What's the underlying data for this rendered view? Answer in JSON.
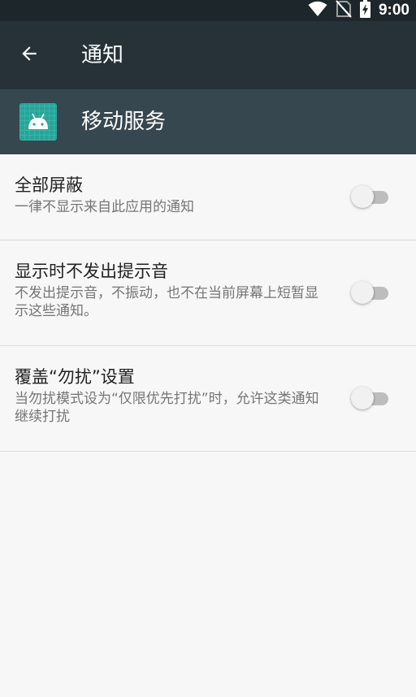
{
  "status_bar": {
    "time": "9:00",
    "icons": [
      "wifi-icon",
      "no-sim-icon",
      "battery-charging-icon"
    ]
  },
  "toolbar": {
    "back_icon": "arrow-back-icon",
    "title": "通知"
  },
  "app_header": {
    "icon": "android-app-icon",
    "name": "移动服务"
  },
  "settings": [
    {
      "title": "全部屏蔽",
      "summary": "一律不显示来自此应用的通知",
      "enabled": false
    },
    {
      "title": "显示时不发出提示音",
      "summary": "不发出提示音，不振动，也不在当前屏幕上短暂显示这些通知。",
      "enabled": false
    },
    {
      "title": "覆盖“勿扰”设置",
      "summary": "当勿扰模式设为“仅限优先打扰”时，允许这类通知继续打扰",
      "enabled": false
    }
  ]
}
